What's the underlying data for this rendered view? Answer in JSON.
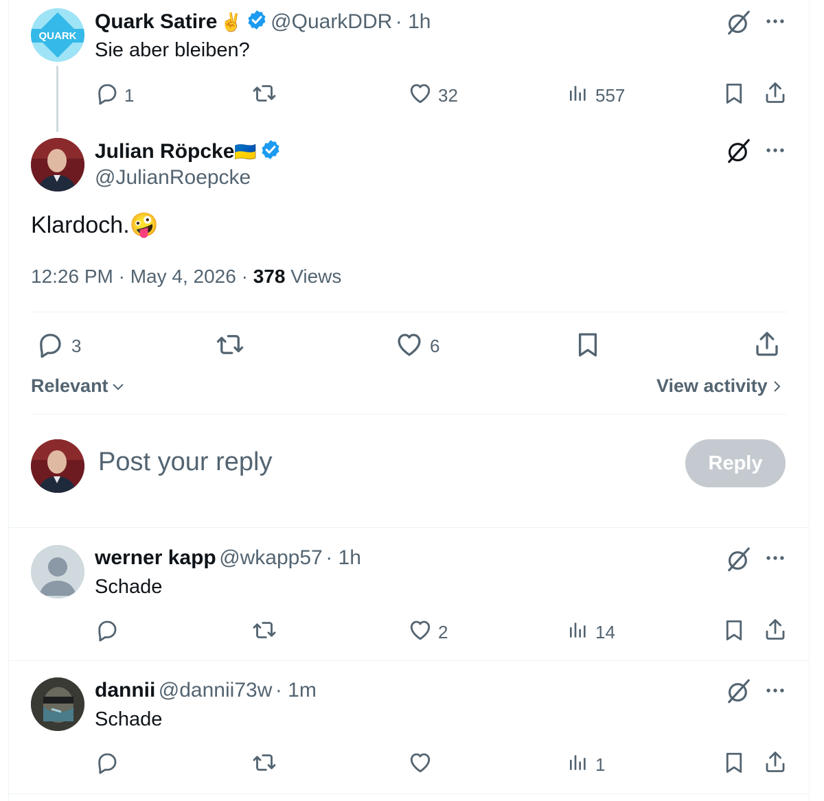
{
  "quoted_tweet": {
    "name": "Quark Satire",
    "name_emoji": "✌️",
    "handle": "@QuarkDDR",
    "time": "· 1h",
    "avatar_label": "QUARK",
    "text": "Sie aber bleiben?",
    "replies": "1",
    "likes": "32",
    "views": "557"
  },
  "main_tweet": {
    "name": "Julian Röpcke",
    "flag": "🇺🇦",
    "handle": "@JulianRoepcke",
    "text": "Klardoch.",
    "emoji": "🤪",
    "timestamp": "12:26 PM · May 4, 2026 ·",
    "views_count": "378",
    "views_label": "Views",
    "replies": "3",
    "likes": "6"
  },
  "sort": {
    "label": "Relevant",
    "view_activity": "View activity"
  },
  "composer": {
    "placeholder": "Post your reply",
    "button": "Reply"
  },
  "replies": [
    {
      "name": "werner kapp",
      "handle": "@wkapp57",
      "time": "· 1h",
      "text": "Schade",
      "replies": "",
      "likes": "2",
      "views": "14"
    },
    {
      "name": "dannii",
      "handle": "@dannii73w",
      "time": "· 1m",
      "text": "Schade",
      "replies": "",
      "likes": "",
      "views": "1"
    }
  ],
  "colors": {
    "verified": "#1d9bf0",
    "muted": "#536471",
    "divider": "#eff3f4",
    "reply_button": "#c4cacf"
  },
  "icons": [
    "reply-icon",
    "retweet-icon",
    "like-icon",
    "views-icon",
    "bookmark-icon",
    "share-icon",
    "grok-icon",
    "more-icon",
    "verified-icon",
    "chevron-down-icon",
    "chevron-right-icon"
  ]
}
